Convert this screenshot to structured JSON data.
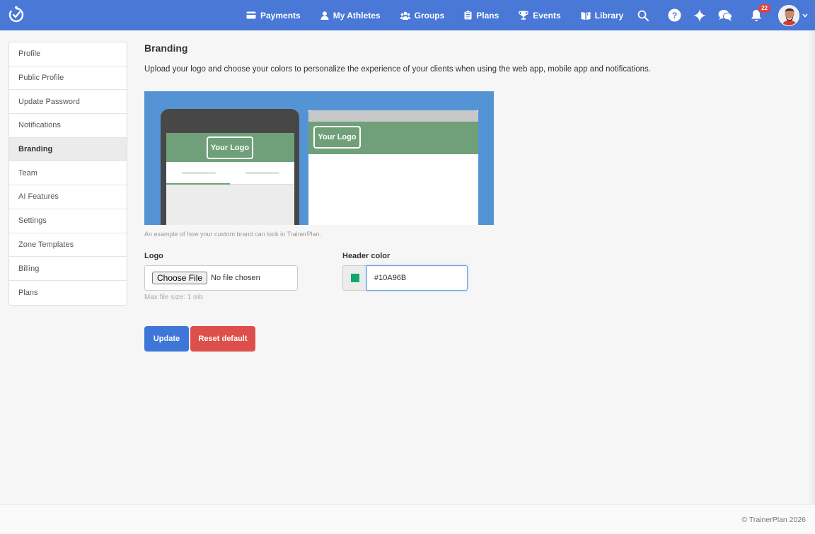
{
  "nav": {
    "items": [
      {
        "label": "Payments",
        "icon": "credit-card-icon"
      },
      {
        "label": "My Athletes",
        "icon": "user-icon"
      },
      {
        "label": "Groups",
        "icon": "group-icon"
      },
      {
        "label": "Plans",
        "icon": "clipboard-icon"
      },
      {
        "label": "Events",
        "icon": "trophy-icon"
      },
      {
        "label": "Library",
        "icon": "book-icon"
      }
    ],
    "notification_count": "22",
    "brand_color": "#4a78d6"
  },
  "sidebar": {
    "items": [
      {
        "label": "Profile"
      },
      {
        "label": "Public Profile"
      },
      {
        "label": "Update Password"
      },
      {
        "label": "Notifications"
      },
      {
        "label": "Branding",
        "active": true
      },
      {
        "label": "Team"
      },
      {
        "label": "AI Features"
      },
      {
        "label": "Settings"
      },
      {
        "label": "Zone Templates"
      },
      {
        "label": "Billing"
      },
      {
        "label": "Plans"
      }
    ]
  },
  "main": {
    "title": "Branding",
    "description": "Upload your logo and choose your colors to personalize the experience of your clients when using the web app, mobile app and notifications.",
    "preview": {
      "logo_text": "Your Logo",
      "caption": "An example of how your custom brand can look in TrainerPlan."
    },
    "logo": {
      "label": "Logo",
      "button_label": "Choose File",
      "status": "No file chosen",
      "help": "Max file size: 1 mb"
    },
    "header_color": {
      "label": "Header color",
      "value": "#10A96B",
      "swatch_color": "#10a96b"
    },
    "update_label": "Update",
    "reset_label": "Reset default"
  },
  "footer": {
    "copyright": "© TrainerPlan 2026"
  }
}
